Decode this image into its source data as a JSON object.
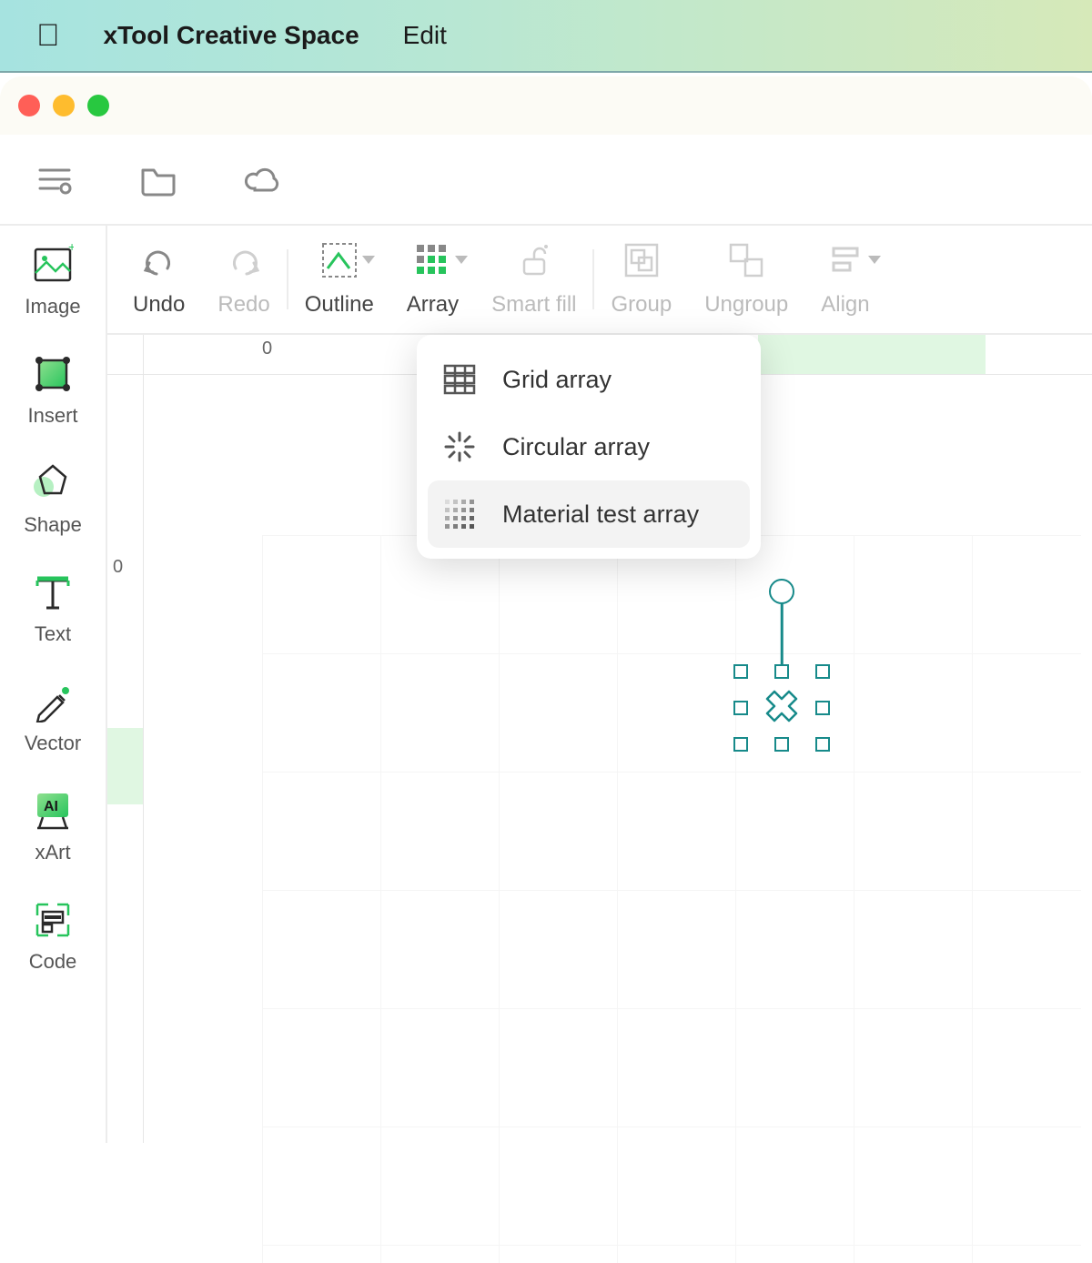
{
  "menubar": {
    "app_name": "xTool Creative Space",
    "items": [
      "Edit"
    ]
  },
  "sidebar": {
    "items": [
      {
        "label": "Image",
        "icon": "image"
      },
      {
        "label": "Insert",
        "icon": "insert"
      },
      {
        "label": "Shape",
        "icon": "shape"
      },
      {
        "label": "Text",
        "icon": "text"
      },
      {
        "label": "Vector",
        "icon": "vector"
      },
      {
        "label": "xArt",
        "icon": "xart"
      },
      {
        "label": "Code",
        "icon": "code"
      }
    ]
  },
  "actionbar": {
    "undo": "Undo",
    "redo": "Redo",
    "outline": "Outline",
    "array": "Array",
    "smartfill": "Smart fill",
    "group": "Group",
    "ungroup": "Ungroup",
    "align": "Align"
  },
  "array_menu": {
    "items": [
      {
        "label": "Grid array"
      },
      {
        "label": "Circular array"
      },
      {
        "label": "Material test array"
      }
    ]
  },
  "ruler": {
    "h_zero": "0",
    "v_zero": "0"
  }
}
